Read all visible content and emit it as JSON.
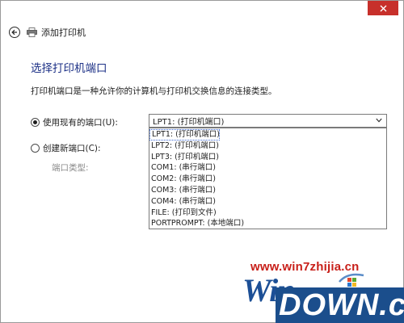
{
  "nav": {
    "title": "添加打印机"
  },
  "content": {
    "heading": "选择打印机端口",
    "description": "打印机端口是一种允许你的计算机与打印机交换信息的连接类型。",
    "use_existing_label": "使用现有的端口(U):",
    "create_new_label": "创建新端口(C):",
    "port_type_label": "端口类型:"
  },
  "port_select": {
    "selected": "LPT1: (打印机端口)",
    "options": [
      "LPT1: (打印机端口)",
      "LPT2: (打印机端口)",
      "LPT3: (打印机端口)",
      "COM1: (串行端口)",
      "COM2: (串行端口)",
      "COM3: (串行端口)",
      "COM4: (串行端口)",
      "FILE: (打印到文件)",
      "PORTPROMPT: (本地端口)"
    ]
  },
  "watermark": {
    "url": "www.win7zhijia.cn",
    "win_text": "Win",
    "down_text": "DOWN.cc"
  },
  "colors": {
    "heading": "#1e3287",
    "close": "#c7302b",
    "selection_border": "#3d6bd8",
    "watermark_red": "#c8201a",
    "watermark_blue": "#1b4e8c"
  },
  "icons": [
    "close-icon",
    "back-arrow-icon",
    "printer-icon",
    "chevron-down-icon"
  ]
}
